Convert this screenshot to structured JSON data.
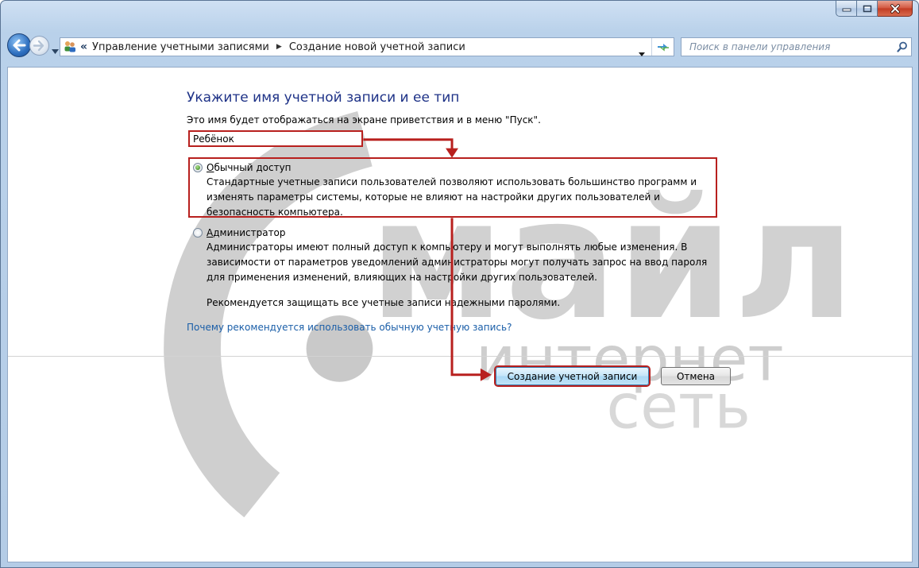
{
  "address_bar": {
    "crumbs": [
      "Управление учетными записями",
      "Создание новой учетной записи"
    ],
    "overflow_chevron": "«"
  },
  "search": {
    "placeholder": "Поиск в панели управления"
  },
  "page": {
    "heading": "Укажите имя учетной записи и ее тип",
    "description": "Это имя будет отображаться на экране приветствия и в меню \"Пуск\".",
    "account_name": "Ребёнок",
    "options": [
      {
        "title_accel": "О",
        "title_rest": "бычный доступ",
        "description": "Стандартные учетные записи пользователей позволяют использовать большинство программ и изменять параметры системы, которые не влияют на настройки других пользователей и безопасность компьютера.",
        "selected": true
      },
      {
        "title_accel": "А",
        "title_rest": "дминистратор",
        "description": "Администраторы имеют полный доступ к компьютеру и могут выполнять любые изменения. В зависимости от параметров уведомлений администраторы могут получать запрос на ввод пароля для применения изменений, влияющих на настройки других пользователей.",
        "selected": false
      }
    ],
    "recommendation": "Рекомендуется защищать все учетные записи надежными паролями.",
    "why_link": "Почему рекомендуется использовать обычную учетную запись?",
    "create_button": "Создание учетной записи",
    "cancel_button": "Отмена"
  },
  "watermark": {
    "line1": "майл",
    "line2": "интернет",
    "line3": "сеть"
  },
  "colors": {
    "annotation_red": "#b8201e",
    "heading_blue": "#1e3287",
    "link_blue": "#1a5ea8",
    "watermark_gray": "#c9c9c9"
  },
  "icons": [
    "back-arrow-icon",
    "forward-arrow-icon",
    "control-panel-users-icon",
    "refresh-icon",
    "search-icon",
    "minimize-icon",
    "maximize-icon",
    "close-icon"
  ]
}
